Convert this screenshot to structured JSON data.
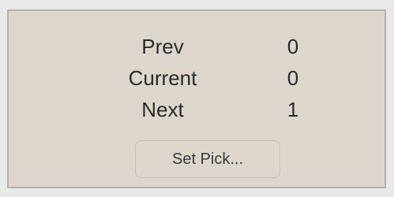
{
  "pick_panel": {
    "rows": [
      {
        "label": "Prev",
        "value": "0"
      },
      {
        "label": "Current",
        "value": "0"
      },
      {
        "label": "Next",
        "value": "1"
      }
    ],
    "set_pick_label": "Set Pick...",
    "colors": {
      "page_background": "#e9e9e9",
      "panel_background": "#ddd6cc",
      "panel_border": "#b8b2a8",
      "text": "#2a2a2a",
      "button_border": "#c6bfb4"
    }
  }
}
